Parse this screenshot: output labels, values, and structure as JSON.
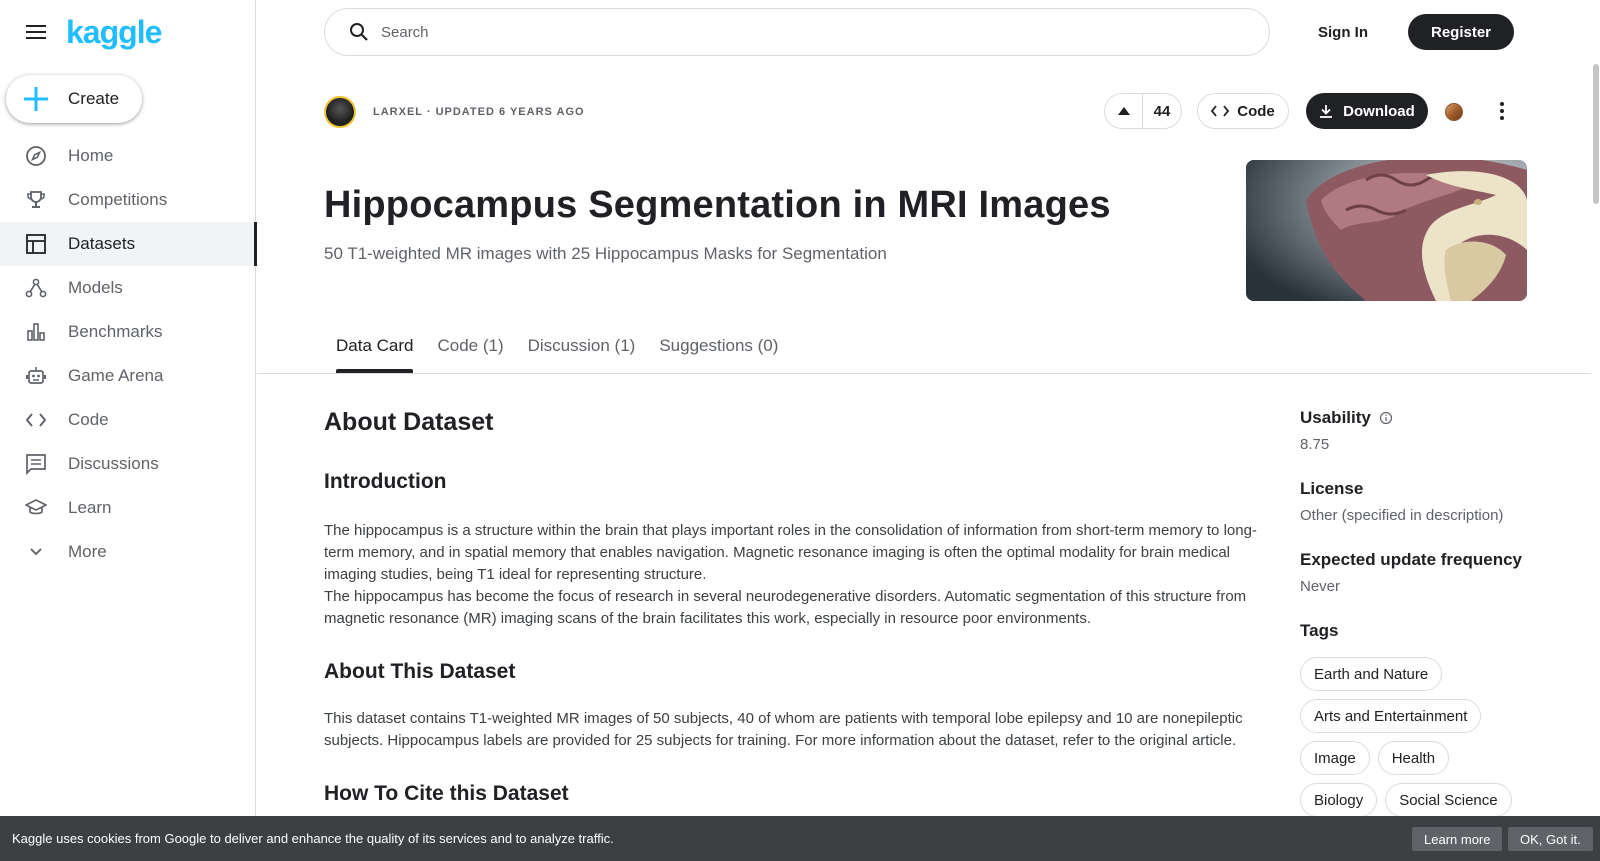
{
  "brand": {
    "logo": "kaggle",
    "accent": "#20beff"
  },
  "sidebar": {
    "create_label": "Create",
    "items": [
      {
        "label": "Home",
        "icon": "compass-icon"
      },
      {
        "label": "Competitions",
        "icon": "trophy-icon"
      },
      {
        "label": "Datasets",
        "icon": "table-icon",
        "active": true
      },
      {
        "label": "Models",
        "icon": "models-icon"
      },
      {
        "label": "Benchmarks",
        "icon": "bar-chart-icon"
      },
      {
        "label": "Game Arena",
        "icon": "robot-icon"
      },
      {
        "label": "Code",
        "icon": "code-icon"
      },
      {
        "label": "Discussions",
        "icon": "comment-icon"
      },
      {
        "label": "Learn",
        "icon": "school-icon"
      },
      {
        "label": "More",
        "icon": "chevron-down-icon"
      }
    ]
  },
  "header": {
    "search_placeholder": "Search",
    "signin": "Sign In",
    "register": "Register"
  },
  "dataset": {
    "owner_meta": "LARXEL · UPDATED 6 YEARS AGO",
    "votes": "44",
    "code_label": "Code",
    "download_label": "Download",
    "title": "Hippocampus Segmentation in MRI Images",
    "subtitle": "50 T1-weighted MR images with 25 Hippocampus Masks for Segmentation"
  },
  "tabs": [
    {
      "label": "Data Card",
      "active": true
    },
    {
      "label": "Code (1)"
    },
    {
      "label": "Discussion (1)"
    },
    {
      "label": "Suggestions (0)"
    }
  ],
  "content": {
    "about_heading": "About Dataset",
    "intro_heading": "Introduction",
    "intro_p1": "The hippocampus is a structure within the brain that plays important roles in the consolidation of information from short-term memory to long-term memory, and in spatial memory that enables navigation. Magnetic resonance imaging is often the optimal modality for brain medical imaging studies, being T1 ideal for representing structure.",
    "intro_p2": "The hippocampus has become the focus of research in several neurodegenerative disorders. Automatic segmentation of this structure from magnetic resonance (MR) imaging scans of the brain facilitates this work, especially in resource poor environments.",
    "about_this_heading": "About This Dataset",
    "about_this_p": "This dataset contains T1-weighted MR images of 50 subjects, 40 of whom are patients with temporal lobe epilepsy and 10 are nonepileptic subjects. Hippocampus labels are provided for 25 subjects for training. For more information about the dataset, refer to the original article.",
    "cite_heading": "How To Cite this Dataset"
  },
  "meta": {
    "usability_label": "Usability",
    "usability_value": "8.75",
    "license_label": "License",
    "license_value": "Other (specified in description)",
    "frequency_label": "Expected update frequency",
    "frequency_value": "Never",
    "tags_label": "Tags",
    "tags": [
      "Earth and Nature",
      "Arts and Entertainment",
      "Image",
      "Health",
      "Biology",
      "Social Science"
    ]
  },
  "cookie": {
    "text": "Kaggle uses cookies from Google to deliver and enhance the quality of its services and to analyze traffic.",
    "learn_more": "Learn more",
    "ok": "OK, Got it."
  }
}
